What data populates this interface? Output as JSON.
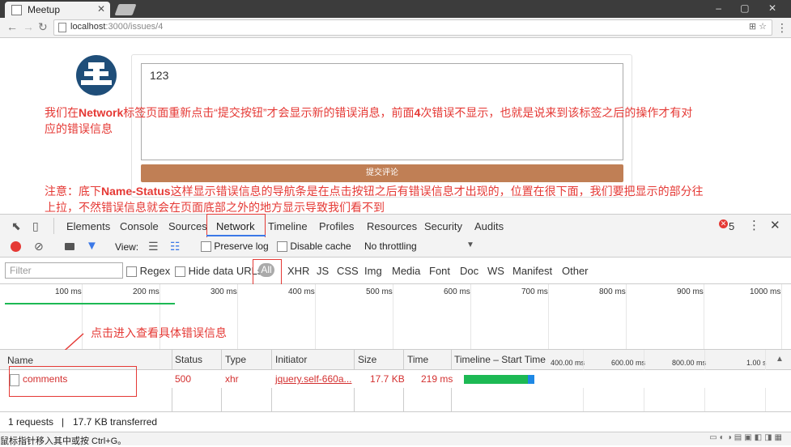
{
  "browser": {
    "tab_title": "Meetup",
    "url_host": "localhost",
    "url_path": ":3000/issues/4",
    "window_controls": "– ▢ ✕"
  },
  "page": {
    "textarea_value": "123",
    "submit_label": "提交评论"
  },
  "annotations": {
    "note1_pre": "我们在",
    "note1_bold": "Network",
    "note1_post": "标签页面重新点击“提交按钮”才会显示新的错误消息，前面",
    "note1_bold2": "4",
    "note1_post2": "次错误不显示，也就是说来到该标签之后的操作才有对",
    "note1_line2": "应的错误信息",
    "note2_pre": "注意：底下",
    "note2_bold": "Name-Status",
    "note2_post": "这样显示错误信息的导航条是在点击按钮之后有错误信息才出现的，位置在很下面，我们要把显示的部分往",
    "note2_line2": "上拉，不然错误信息就会在页面底部之外的地方显示导致我们看不到",
    "arrow_label": "点击进入查看具体错误信息"
  },
  "devtools": {
    "tabs": [
      "Elements",
      "Console",
      "Sources",
      "Network",
      "Timeline",
      "Profiles",
      "Resources",
      "Security",
      "Audits"
    ],
    "active_tab": "Network",
    "error_count": "5",
    "toolbar": {
      "view_label": "View:",
      "preserve_log": "Preserve log",
      "disable_cache": "Disable cache",
      "throttling": "No throttling"
    },
    "filter": {
      "placeholder": "Filter",
      "regex": "Regex",
      "hide_data_urls": "Hide data URLs",
      "types": [
        "All",
        "XHR",
        "JS",
        "CSS",
        "Img",
        "Media",
        "Font",
        "Doc",
        "WS",
        "Manifest",
        "Other"
      ]
    },
    "overview_ticks": [
      "100 ms",
      "200 ms",
      "300 ms",
      "400 ms",
      "500 ms",
      "600 ms",
      "700 ms",
      "800 ms",
      "900 ms",
      "1000 ms"
    ],
    "columns": [
      "Name",
      "Status",
      "Type",
      "Initiator",
      "Size",
      "Time",
      "Timeline – Start Time"
    ],
    "waterfall_ticks": [
      "400.00 ms",
      "600.00 ms",
      "800.00 ms",
      "1.00 s"
    ],
    "rows": [
      {
        "name": "comments",
        "status": "500",
        "type": "xhr",
        "initiator": "jquery.self-660a...",
        "size": "17.7 KB",
        "time": "219 ms"
      }
    ],
    "summary_requests": "1 requests",
    "summary_sep": "|",
    "summary_transferred": "17.7 KB transferred"
  },
  "statusbar": {
    "text": "鼠标指针移入其中或按 Ctrl+G。"
  },
  "colors": {
    "annotation": "#e53935",
    "submit_button": "#c07f55",
    "avatar": "#1f4e79",
    "timing_bar": "#1db954"
  }
}
